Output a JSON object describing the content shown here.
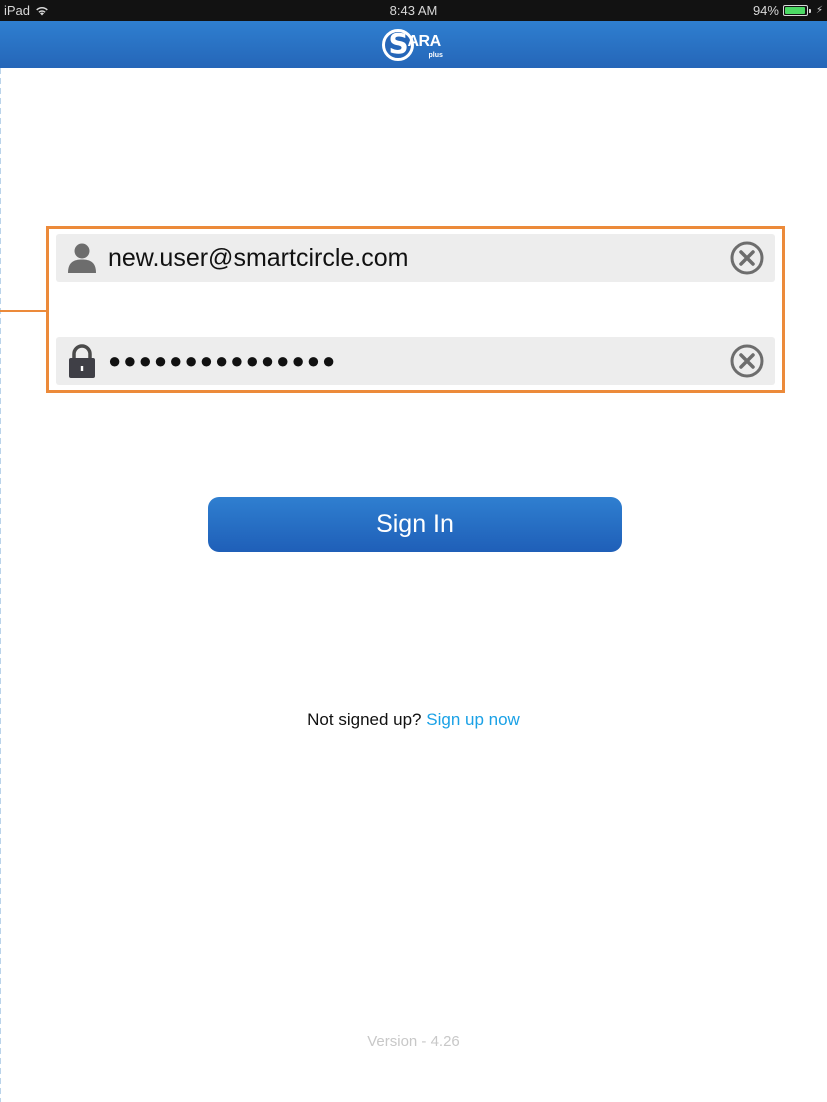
{
  "status_bar": {
    "device": "iPad",
    "time": "8:43 AM",
    "battery_percent": "94%",
    "battery_level": 0.94
  },
  "nav_bar": {
    "logo_text": "ARA",
    "logo_initial": "S",
    "logo_subtext": "plus"
  },
  "login": {
    "username_value": "new.user@smartcircle.com",
    "password_mask": "●●●●●●●●●●●●●●●",
    "sign_in_label": "Sign In",
    "signup_prompt": "Not signed up?",
    "signup_link": "Sign up now"
  },
  "footer": {
    "version": "Version - 4.26"
  },
  "colors": {
    "brand_blue": "#2566b8",
    "link_blue": "#1aa1e6",
    "highlight_orange": "#ec8a3a"
  }
}
